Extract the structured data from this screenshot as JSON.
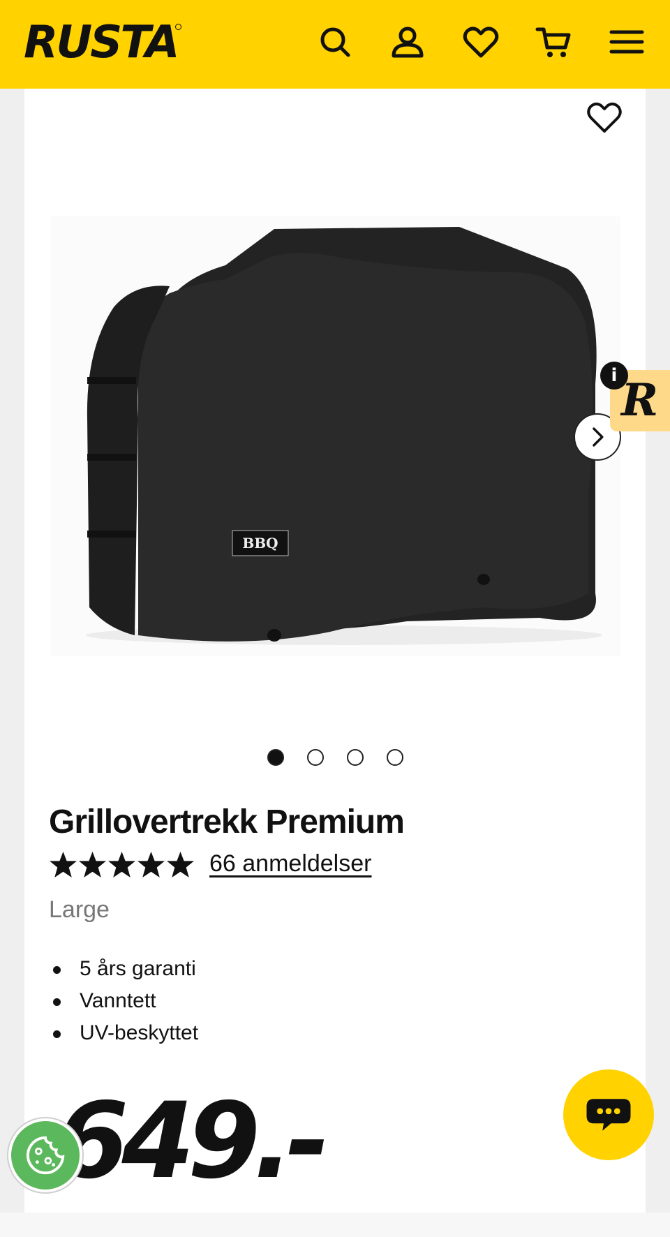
{
  "header": {
    "logo": "RUSTA",
    "icons": [
      "search-icon",
      "account-icon",
      "heart-icon",
      "cart-icon",
      "menu-icon"
    ]
  },
  "product": {
    "title": "Grillovertrekk Premium",
    "rating": 5,
    "rating_max": 5,
    "reviews_label": "66 anmeldelser",
    "variant": "Large",
    "features": [
      "5 års garanti",
      "Vanntett",
      "UV-beskyttet"
    ],
    "price": "649.-",
    "image_label": "BBQ",
    "gallery_total": 4,
    "gallery_active": 1
  },
  "widgets": {
    "r_badge_letter": "R",
    "info_label": "i"
  },
  "colors": {
    "brand_yellow": "#ffd200",
    "cookie_green": "#5cb85c",
    "r_badge": "#ffd98a"
  }
}
